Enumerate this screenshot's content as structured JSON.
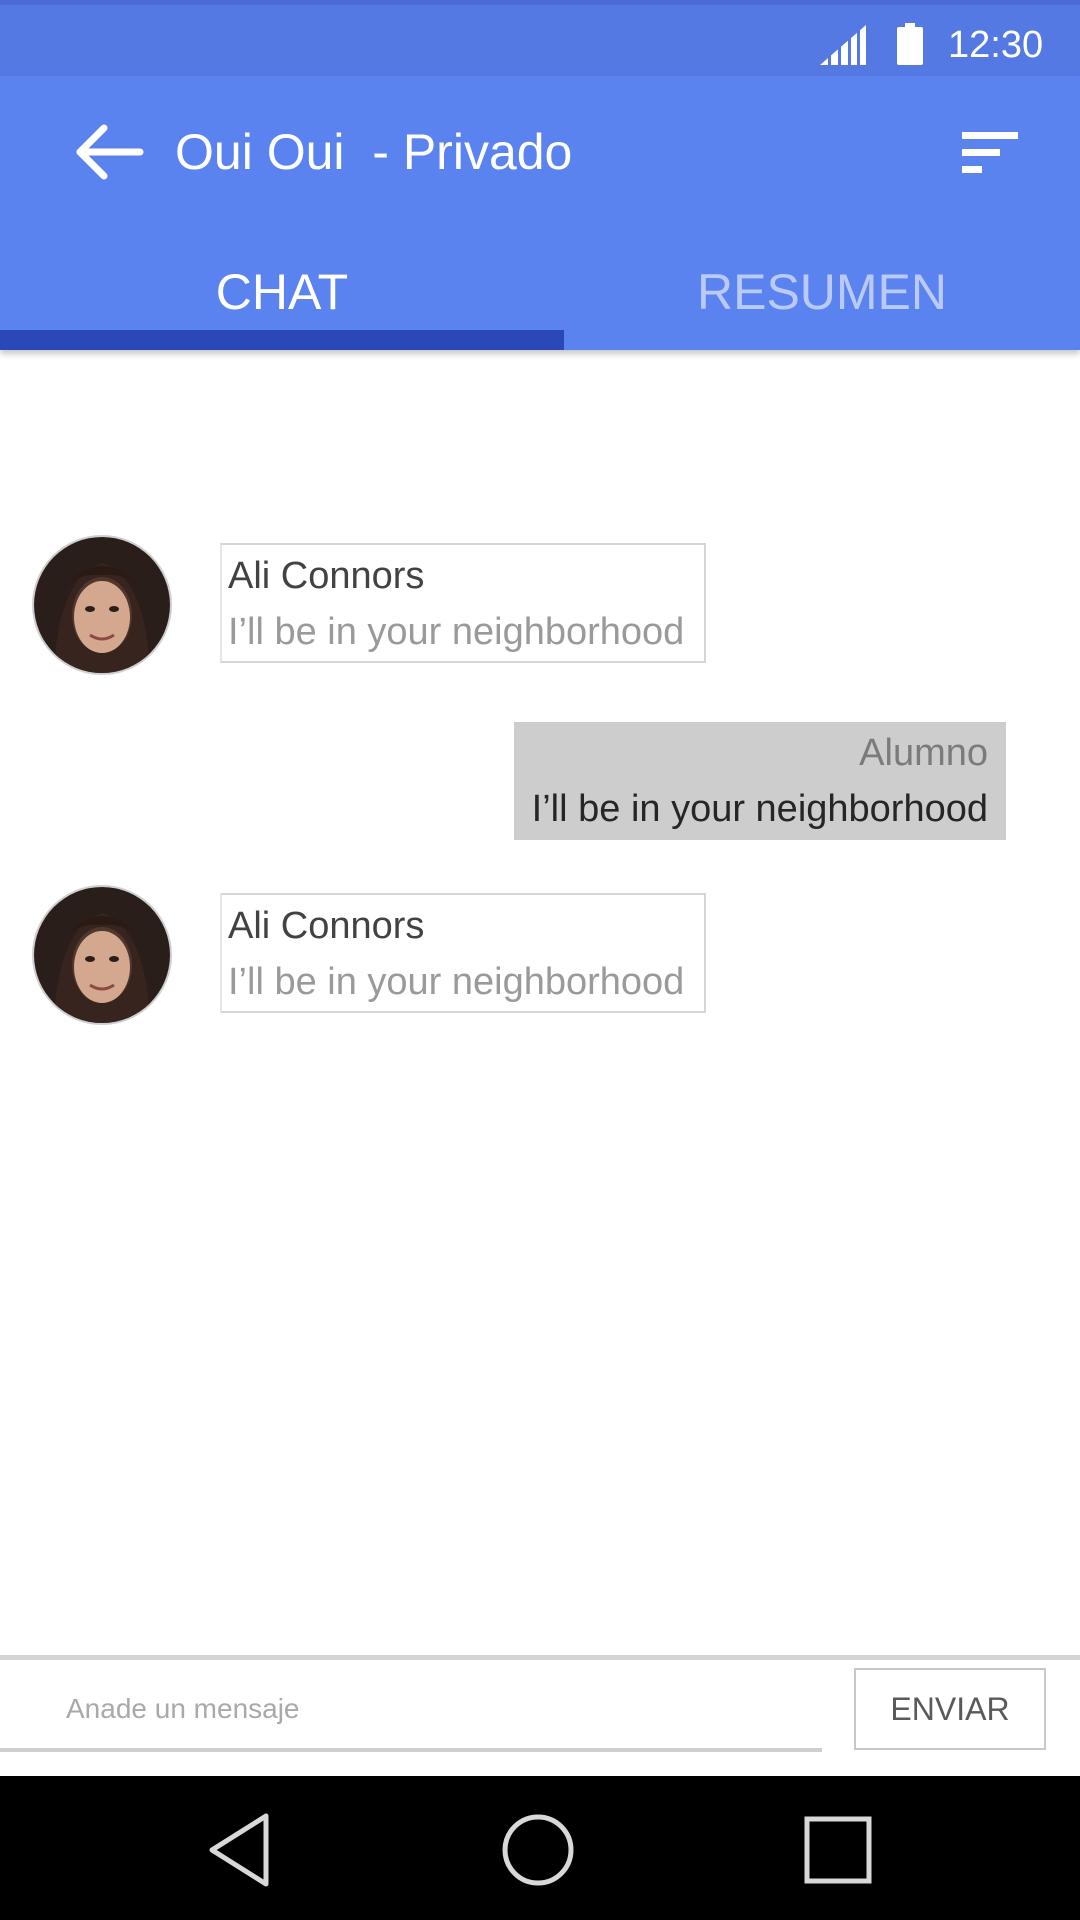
{
  "status_bar": {
    "time": "12:30",
    "icons": [
      "signal-icon",
      "battery-icon"
    ]
  },
  "app_bar": {
    "title": "Oui Oui  - Privado",
    "back_icon": "arrow-back-icon",
    "filter_icon": "sort-icon",
    "color": "#5b83ef"
  },
  "tabs": [
    {
      "label": "CHAT",
      "selected": true
    },
    {
      "label": "RESUMEN",
      "selected": false
    }
  ],
  "messages": [
    {
      "direction": "incoming",
      "sender": "Ali Connors",
      "text": "I’ll be in your neighborhood",
      "avatar": "avatar-photo"
    },
    {
      "direction": "outgoing",
      "sender": "Alumno",
      "text": "I’ll be in your neighborhood"
    },
    {
      "direction": "incoming",
      "sender": "Ali Connors",
      "text": "I’ll be in your neighborhood",
      "avatar": "avatar-photo"
    }
  ],
  "composer": {
    "placeholder": "Anade un mensaje",
    "value": "",
    "send_label": "ENVIAR"
  },
  "nav_bar": {
    "icons": [
      "nav-back-icon",
      "nav-home-icon",
      "nav-recents-icon"
    ]
  },
  "colors": {
    "status_bar": "#5579e2",
    "tab_indicator": "#2a48b8",
    "outgoing_bubble": "#cdcdcd"
  }
}
